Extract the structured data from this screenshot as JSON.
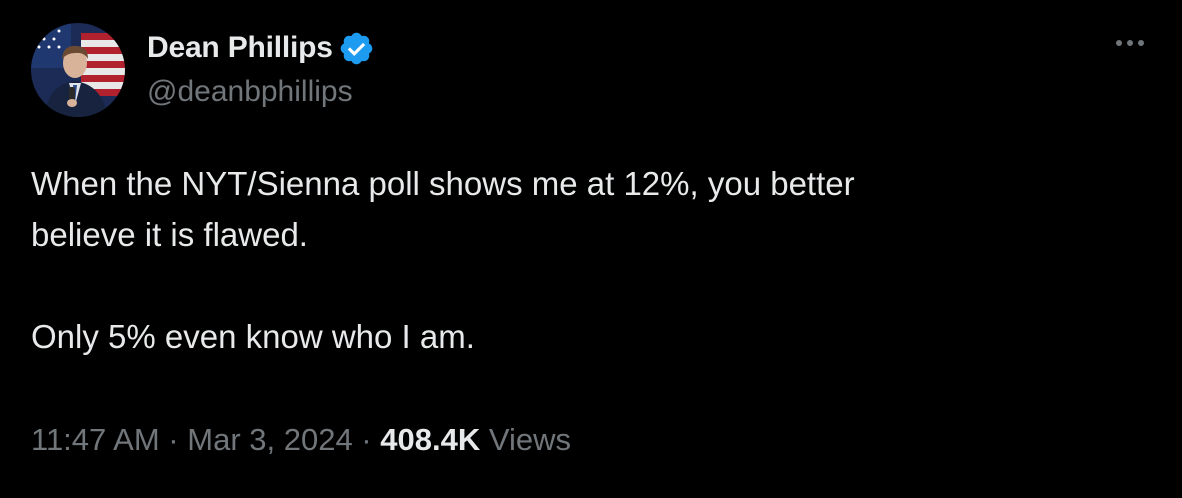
{
  "author": {
    "display_name": "Dean Phillips",
    "handle": "@deanbphillips",
    "verified": true
  },
  "tweet": {
    "line1": "When the NYT/Sienna poll shows me at 12%, you better",
    "line2": "believe it is flawed.",
    "line3": "Only 5% even know who I am."
  },
  "meta": {
    "time": "11:47 AM",
    "separator": " · ",
    "date": "Mar 3, 2024",
    "views_count": "408.4K",
    "views_label": "Views"
  },
  "icons": {
    "verified": "verified-badge-icon",
    "more": "more-options-icon"
  },
  "colors": {
    "background": "#000000",
    "primary_text": "#e7e9ea",
    "secondary_text": "#71767b",
    "verified_blue": "#1d9bf0"
  }
}
